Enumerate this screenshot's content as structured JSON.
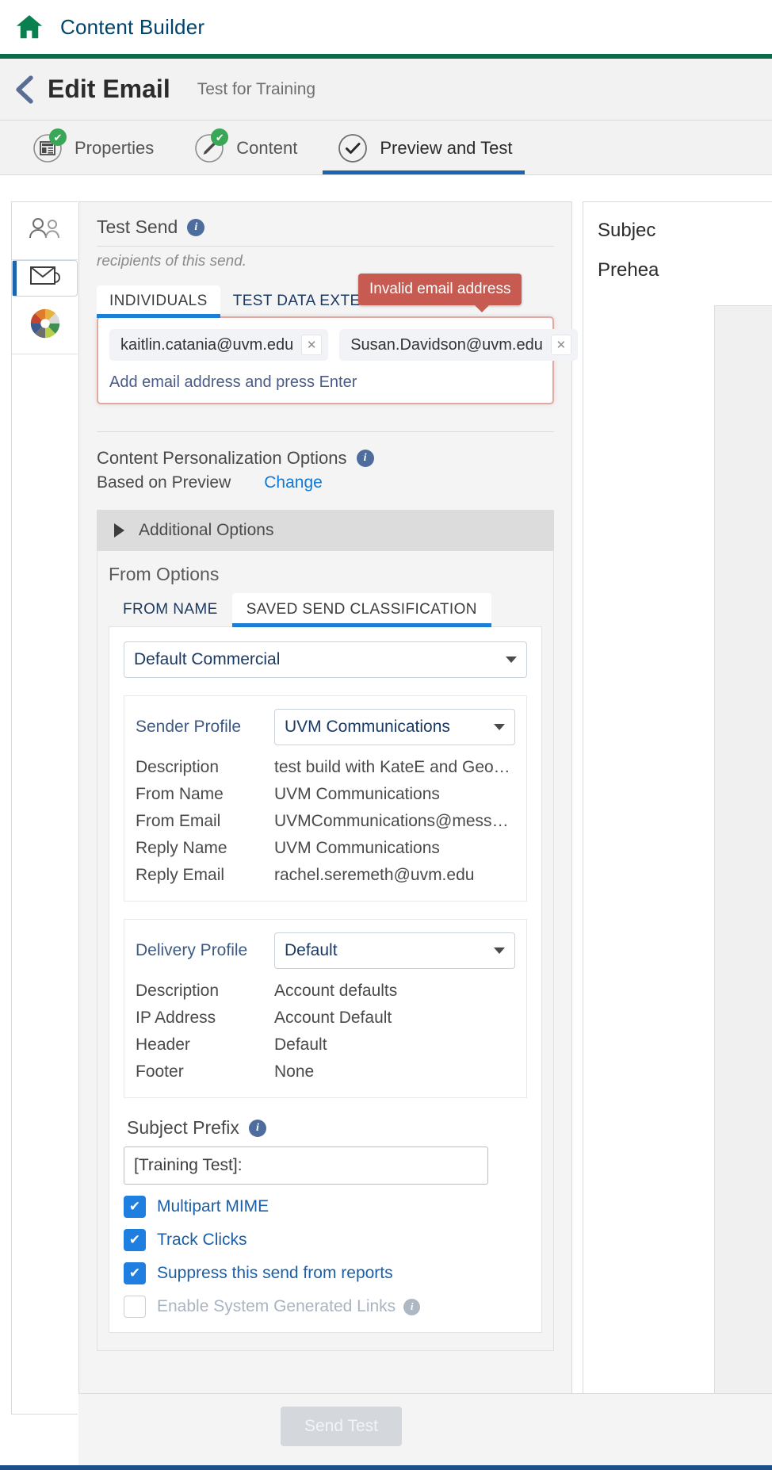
{
  "app": {
    "home_icon": "home-icon",
    "title": "Content Builder",
    "accent_green": "#0a6b4a",
    "accent_blue": "#1c7fd6",
    "error_red": "#c75b52"
  },
  "page": {
    "back_icon": "chevron-left-icon",
    "title": "Edit Email",
    "subtitle": "Test for Training"
  },
  "wizard": {
    "tabs": [
      {
        "label": "Properties",
        "icon": "properties-icon",
        "status": "complete",
        "active": false
      },
      {
        "label": "Content",
        "icon": "pencil-icon",
        "status": "complete",
        "active": false
      },
      {
        "label": "Preview and Test",
        "icon": "check-circle-icon",
        "status": "current",
        "active": true
      }
    ],
    "check_glyph": "✔"
  },
  "rail": {
    "items": [
      {
        "icon": "audience-icon",
        "selected": false
      },
      {
        "icon": "envelope-preview-icon",
        "selected": true
      },
      {
        "icon": "color-wheel-icon",
        "selected": false
      }
    ]
  },
  "test_send": {
    "title": "Test Send",
    "info_icon": "info-icon",
    "subtitle": "recipients of this send.",
    "tabs": [
      {
        "label": "INDIVIDUALS",
        "active": true
      },
      {
        "label": "TEST DATA EXTENSION",
        "active": false
      }
    ],
    "tooltip": "Invalid email address",
    "chips": [
      {
        "email": "kaitlin.catania@uvm.edu",
        "remove_icon": "close-icon"
      },
      {
        "email": "Susan.Davidson@uvm.edu",
        "remove_icon": "close-icon"
      }
    ],
    "add_hint": "Add email address and press Enter"
  },
  "personalization": {
    "title": "Content Personalization Options",
    "info_icon": "info-icon",
    "value": "Based on Preview",
    "change_label": "Change"
  },
  "additional_options": {
    "label": "Additional Options",
    "expand_icon": "triangle-right-icon"
  },
  "from_options": {
    "title": "From Options",
    "tabs": [
      {
        "label": "FROM NAME",
        "active": false
      },
      {
        "label": "SAVED SEND CLASSIFICATION",
        "active": true
      }
    ],
    "classification": {
      "value": "Default Commercial",
      "caret_icon": "chevron-down-icon"
    },
    "sender_profile": {
      "label": "Sender Profile",
      "value": "UVM Communications",
      "caret_icon": "chevron-down-icon",
      "rows": [
        {
          "key": "Description",
          "value": "test build with KateE and Geogia"
        },
        {
          "key": "From Name",
          "value": "UVM Communications"
        },
        {
          "key": "From Email",
          "value": "UVMCommunications@message.u…"
        },
        {
          "key": "Reply Name",
          "value": "UVM Communications"
        },
        {
          "key": "Reply Email",
          "value": "rachel.seremeth@uvm.edu"
        }
      ]
    },
    "delivery_profile": {
      "label": "Delivery Profile",
      "value": "Default",
      "caret_icon": "chevron-down-icon",
      "rows": [
        {
          "key": "Description",
          "value": "Account defaults"
        },
        {
          "key": "IP Address",
          "value": "Account Default"
        },
        {
          "key": "Header",
          "value": "Default"
        },
        {
          "key": "Footer",
          "value": "None"
        }
      ]
    }
  },
  "subject_prefix": {
    "label": "Subject Prefix",
    "info_icon": "info-icon",
    "value": "[Training Test]:"
  },
  "checkboxes": [
    {
      "label": "Multipart MIME",
      "checked": true,
      "disabled": false,
      "info": false
    },
    {
      "label": "Track Clicks",
      "checked": true,
      "disabled": false,
      "info": false
    },
    {
      "label": "Suppress this send from reports",
      "checked": true,
      "disabled": false,
      "info": false
    },
    {
      "label": "Enable System Generated Links",
      "checked": false,
      "disabled": true,
      "info": true
    }
  ],
  "check_glyph": "✔",
  "footer": {
    "send_test_label": "Send Test"
  },
  "preview_panel": {
    "subject_label": "Subjec",
    "preheader_label": "Prehea"
  }
}
